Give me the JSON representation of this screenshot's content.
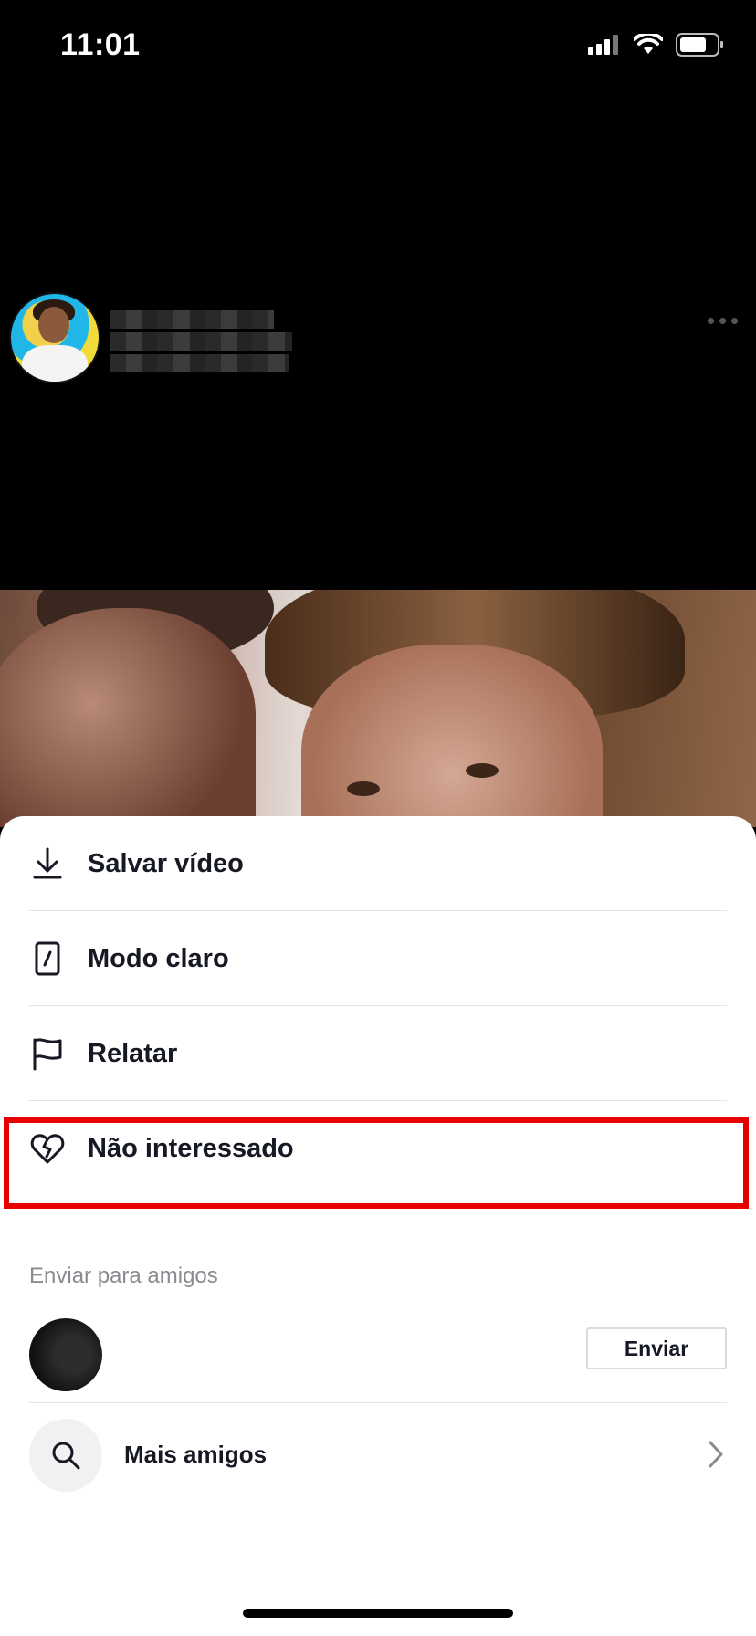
{
  "status_bar": {
    "time": "11:01"
  },
  "menu": {
    "items": [
      {
        "label": "Salvar vídeo",
        "icon": "download-icon"
      },
      {
        "label": "Modo claro",
        "icon": "light-mode-icon"
      },
      {
        "label": "Relatar",
        "icon": "flag-icon"
      },
      {
        "label": "Não interessado",
        "icon": "broken-heart-icon"
      }
    ]
  },
  "share": {
    "section_title": "Enviar para amigos",
    "send_label": "Enviar",
    "more_friends_label": "Mais amigos"
  },
  "colors": {
    "highlight": "#e80000",
    "text": "#161823",
    "muted": "#8a8b91"
  }
}
